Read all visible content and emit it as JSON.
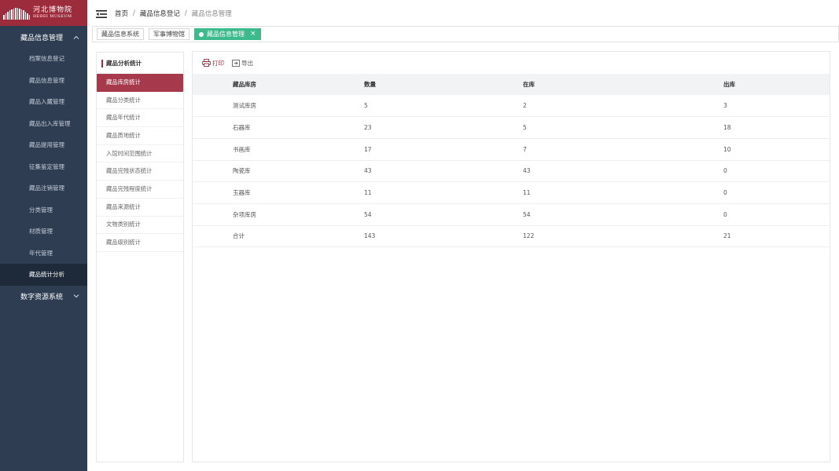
{
  "logo": {
    "cn": "河北博物院",
    "en": "HEBEI MUSEUM"
  },
  "sidebar": {
    "group1": {
      "label": "藏品信息管理",
      "icon": "chevron-up-icon"
    },
    "items": [
      {
        "label": "档案信息登记"
      },
      {
        "label": "藏品信息管理"
      },
      {
        "label": "藏品入藏管理"
      },
      {
        "label": "藏品出入库管理"
      },
      {
        "label": "藏品提用管理"
      },
      {
        "label": "征集鉴定管理"
      },
      {
        "label": "藏品注销管理"
      },
      {
        "label": "分类管理"
      },
      {
        "label": "材质管理"
      },
      {
        "label": "年代管理"
      },
      {
        "label": "藏品统计分析",
        "active": true
      }
    ],
    "group2": {
      "label": "数字资源系统",
      "icon": "chevron-down-icon"
    }
  },
  "breadcrumb": [
    "首页",
    "藏品信息登记",
    "藏品信息管理"
  ],
  "breadcrumb_sep": "/",
  "tabs": [
    {
      "label": "藏品信息系统"
    },
    {
      "label": "军事博物馆"
    },
    {
      "label": "藏品信息管理",
      "active": true,
      "close": "×"
    }
  ],
  "colors": {
    "sidebar": "#2e3d52",
    "brand": "#9c2b3c",
    "active_tab": "#3dba8b"
  },
  "stats": {
    "title": "藏品分析统计",
    "items": [
      "藏品库房统计",
      "藏品分类统计",
      "藏品年代统计",
      "藏品质地统计",
      "入馆时间范围统计",
      "藏品完残状态统计",
      "藏品完残程度统计",
      "藏品来源统计",
      "文物类别统计",
      "藏品级别统计"
    ]
  },
  "toolbar": {
    "print": "打印",
    "export": "导出"
  },
  "table": {
    "headers": [
      "藏品库房",
      "数量",
      "在库",
      "出库"
    ],
    "rows": [
      [
        "测试库房",
        "5",
        "2",
        "3"
      ],
      [
        "石器库",
        "23",
        "5",
        "18"
      ],
      [
        "书画库",
        "17",
        "7",
        "10"
      ],
      [
        "陶瓷库",
        "43",
        "43",
        "0"
      ],
      [
        "玉器库",
        "11",
        "11",
        "0"
      ],
      [
        "杂项库房",
        "54",
        "54",
        "0"
      ],
      [
        "合计",
        "143",
        "122",
        "21"
      ]
    ]
  }
}
